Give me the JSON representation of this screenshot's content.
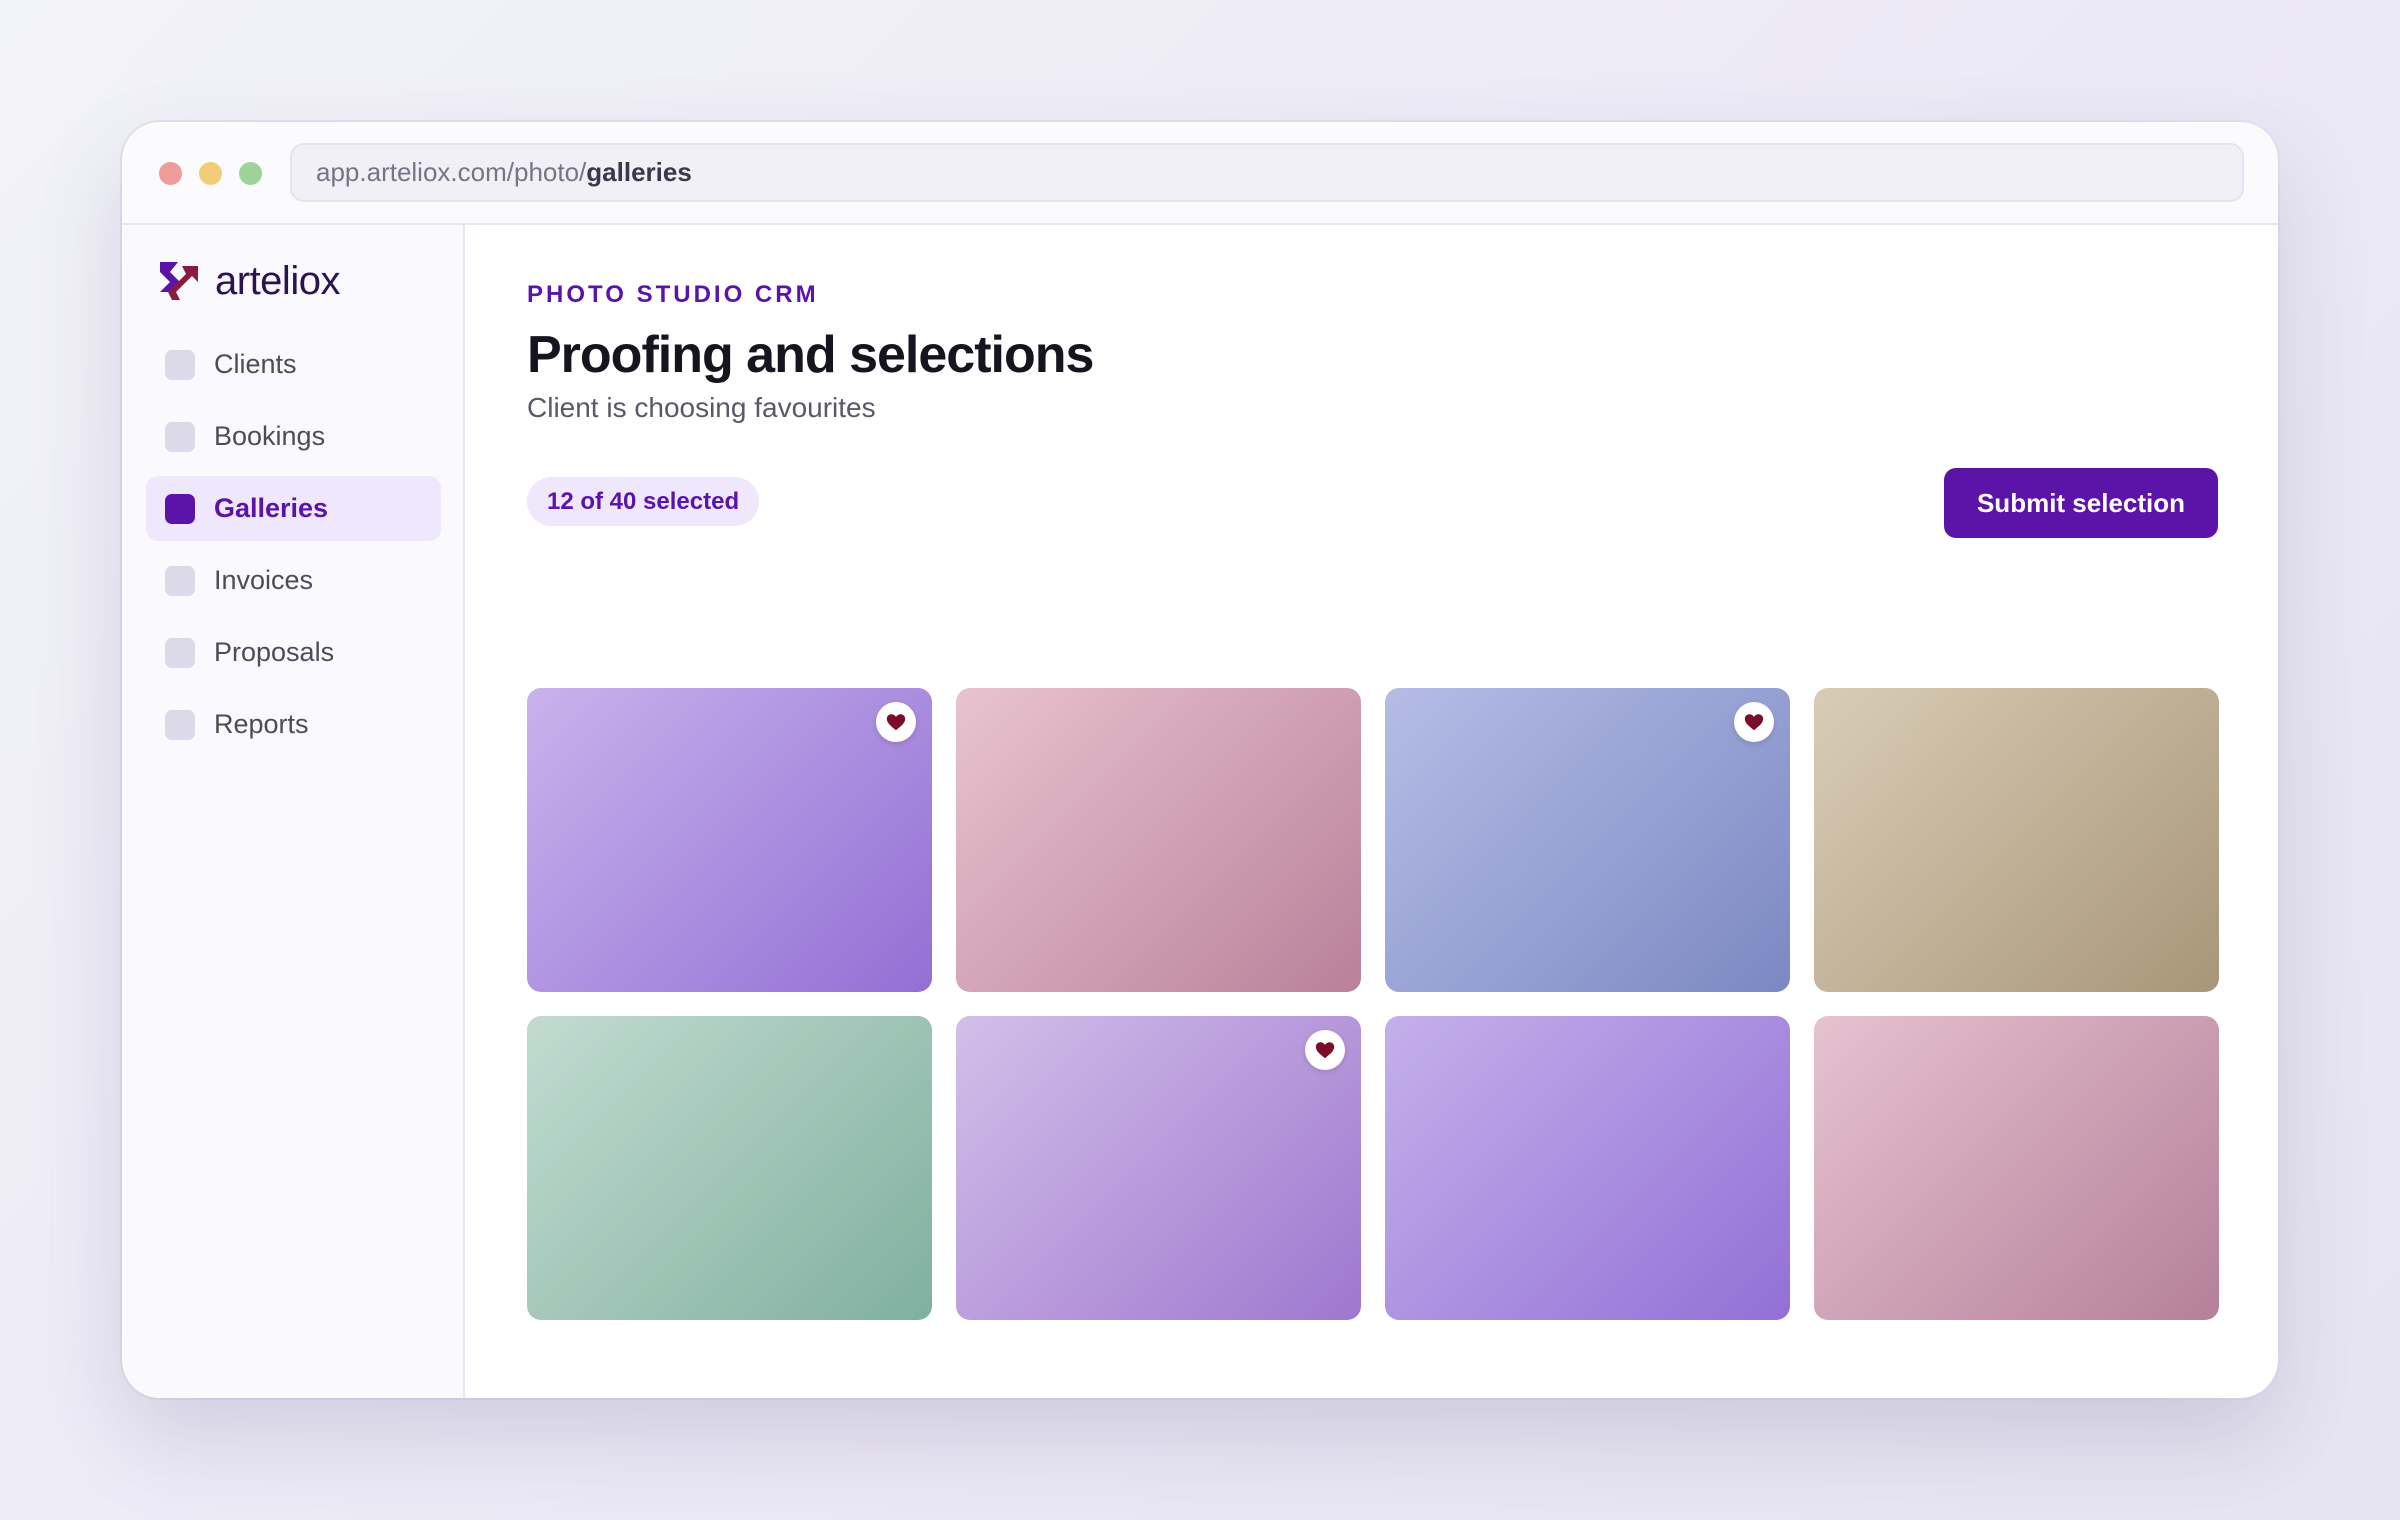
{
  "browser": {
    "url_prefix": "app.arteliox.com/photo/",
    "url_path": "galleries"
  },
  "brand": {
    "name": "arteliox"
  },
  "sidebar": {
    "items": [
      {
        "label": "Clients",
        "active": false
      },
      {
        "label": "Bookings",
        "active": false
      },
      {
        "label": "Galleries",
        "active": true
      },
      {
        "label": "Invoices",
        "active": false
      },
      {
        "label": "Proposals",
        "active": false
      },
      {
        "label": "Reports",
        "active": false
      }
    ]
  },
  "main": {
    "eyebrow": "PHOTO STUDIO CRM",
    "title": "Proofing and selections",
    "subtitle": "Client is choosing favourites",
    "selection_badge": "12 of 40 selected",
    "submit_label": "Submit selection"
  },
  "photos": [
    {
      "favourite": true,
      "from": "#c7b3ec",
      "to": "#936fd4"
    },
    {
      "favourite": false,
      "from": "#e8c3cf",
      "to": "#b9819a"
    },
    {
      "favourite": true,
      "from": "#b5bde6",
      "to": "#7b88c2"
    },
    {
      "favourite": false,
      "from": "#d9ccb7",
      "to": "#a89678"
    },
    {
      "favourite": false,
      "from": "#c2dbd1",
      "to": "#80b09f"
    },
    {
      "favourite": true,
      "from": "#d2bfe9",
      "to": "#9f77cf"
    },
    {
      "favourite": false,
      "from": "#c4b0ea",
      "to": "#9270d6"
    },
    {
      "favourite": false,
      "from": "#e6c2cf",
      "to": "#b5809a"
    }
  ],
  "colors": {
    "accent": "#5b13a8",
    "heart": "#7a0d2a"
  },
  "icons": {
    "favourite": "heart-icon",
    "brand": "arteliox-logo-icon"
  }
}
